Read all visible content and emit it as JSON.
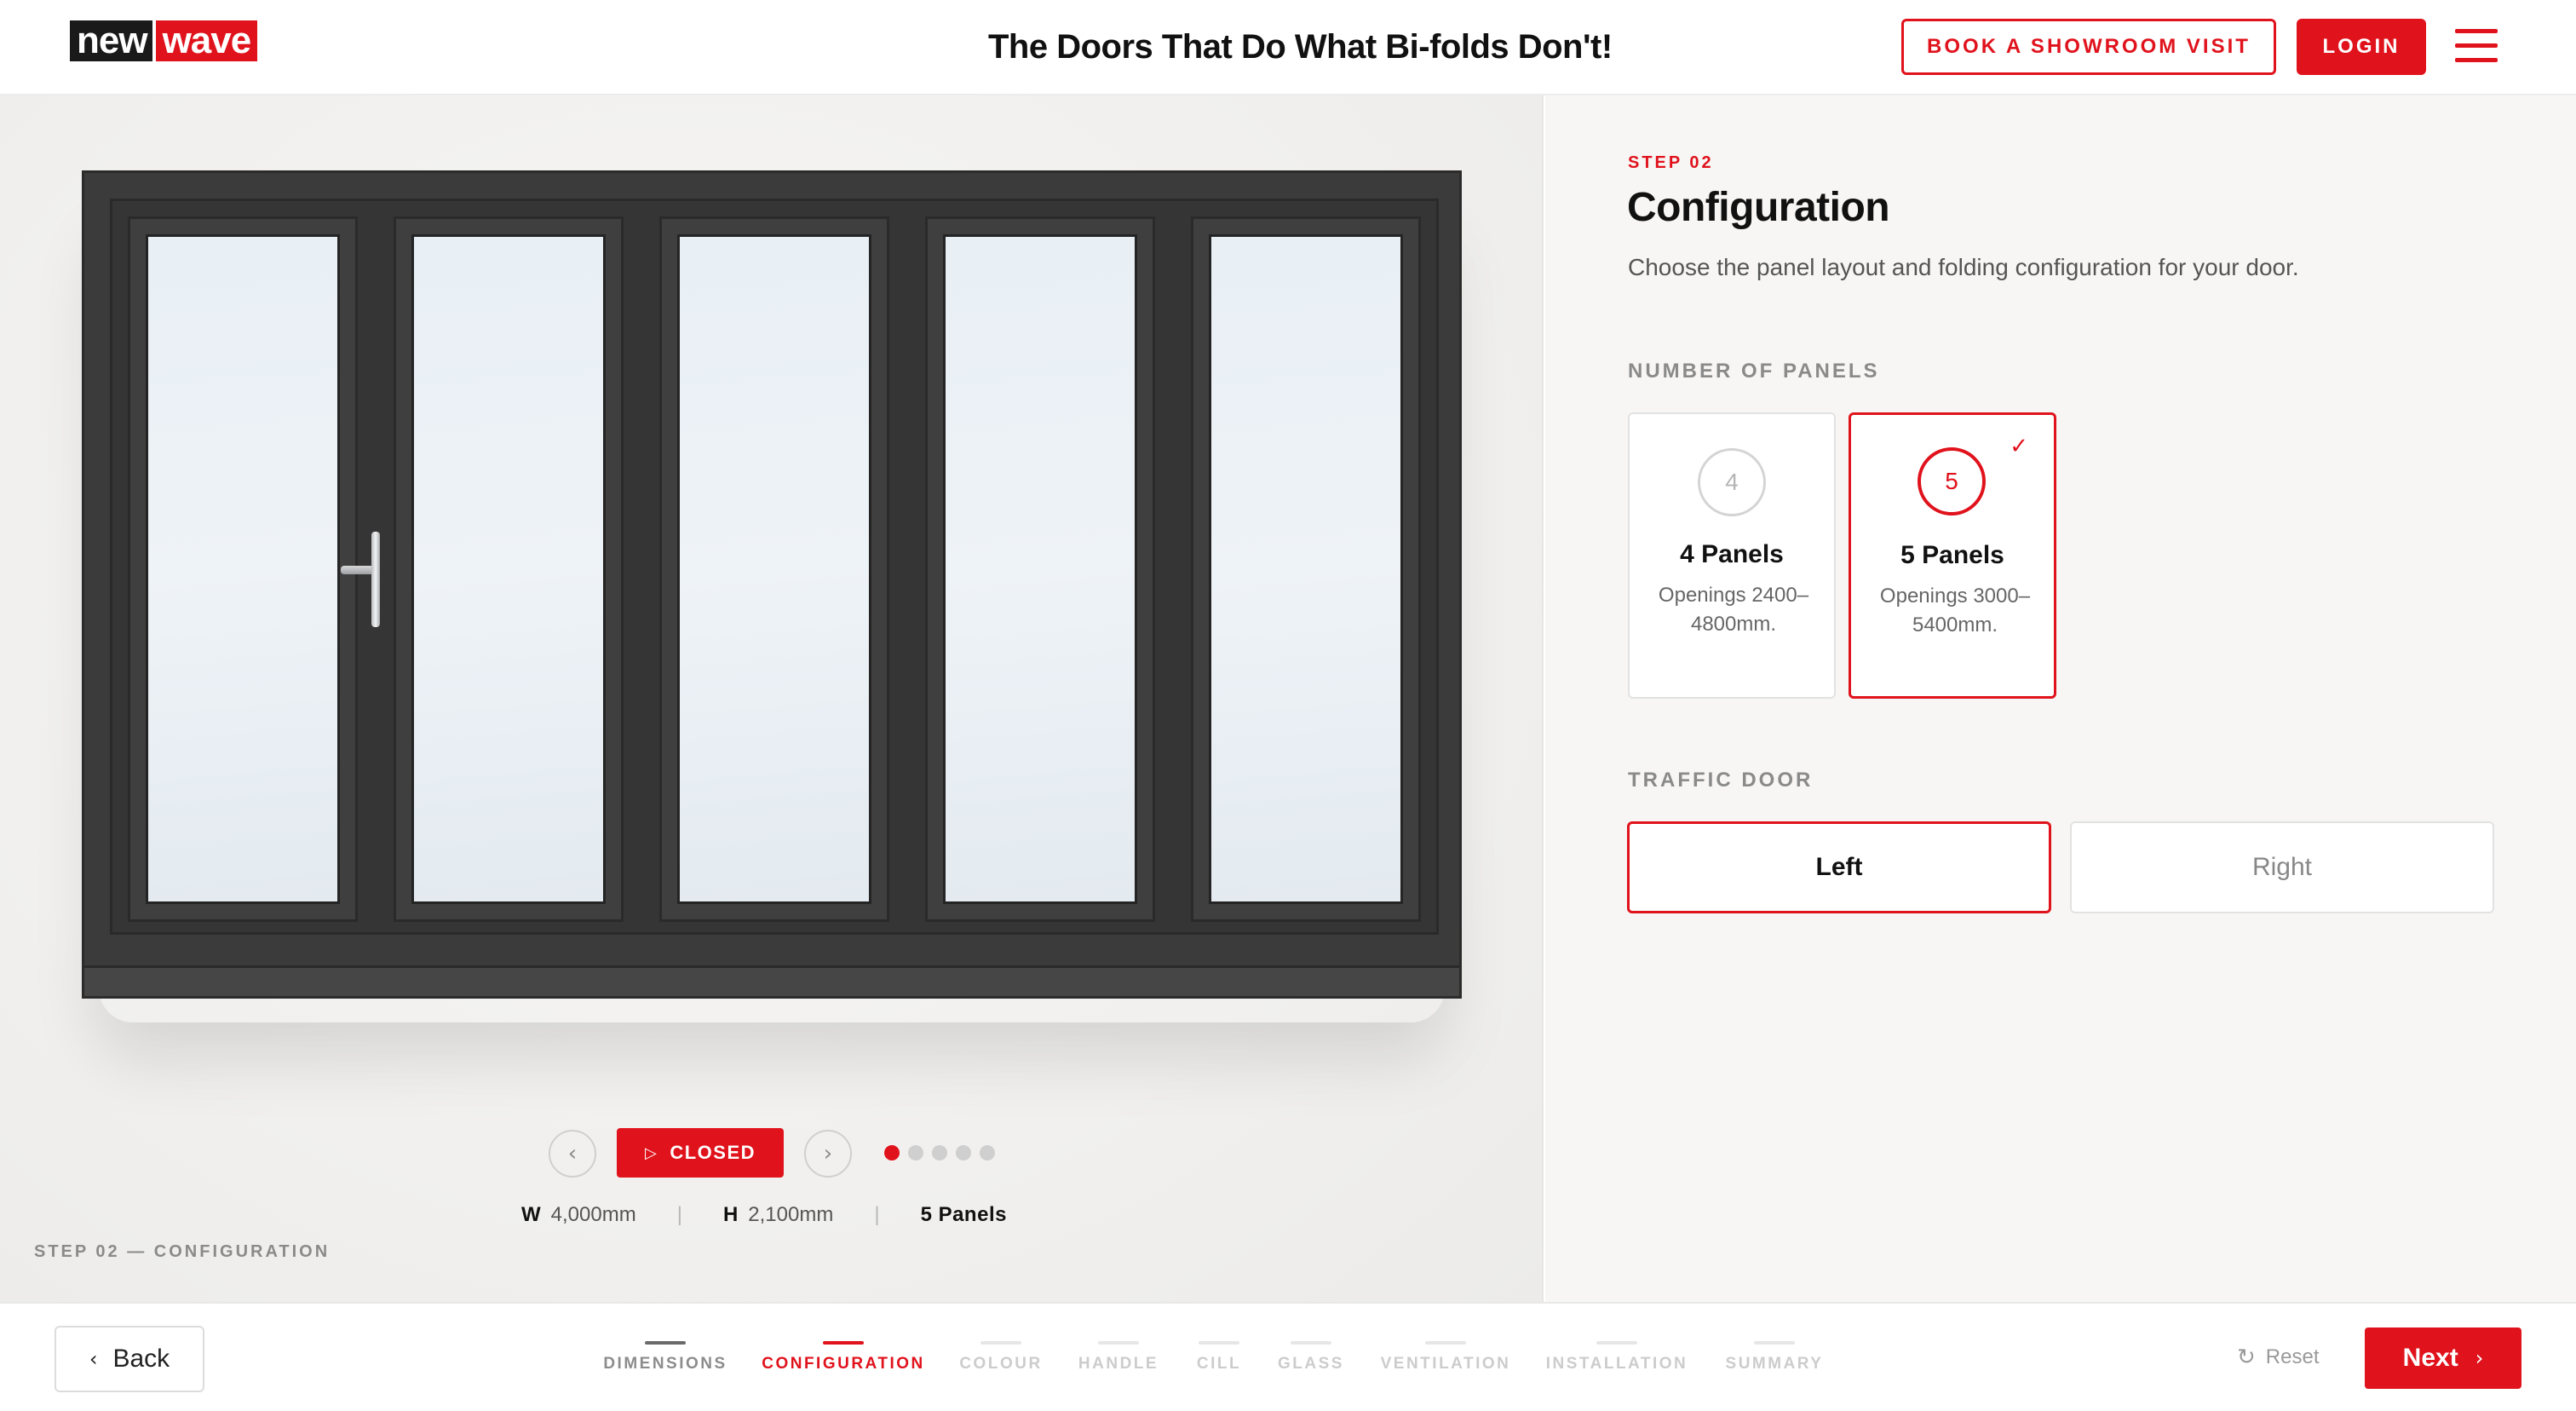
{
  "header": {
    "logo_left": "new",
    "logo_right": "wave",
    "tagline": "The Doors That Do What Bi-folds Don't!",
    "showroom_label": "BOOK A SHOWROOM VISIT",
    "login_label": "LOGIN",
    "menu_icon": "hamburger-icon"
  },
  "preview": {
    "view_state": "CLOSED",
    "prev_icon": "chevron-left-icon",
    "next_icon": "chevron-right-icon",
    "view_count": 5,
    "active_view": 1,
    "width_label": "W",
    "width_value": "4,000mm",
    "height_label": "H",
    "height_value": "2,100mm",
    "panels_value": "5 Panels",
    "step_caption": "STEP 02 — CONFIGURATION",
    "frame_color": "#3b3b3b"
  },
  "config": {
    "step": "STEP 02",
    "title": "Configuration",
    "description": "Choose the panel layout and folding configuration for your door.",
    "panels_section": "NUMBER OF PANELS",
    "panel_options": [
      {
        "number": "4",
        "name": "4 Panels",
        "sub": "Openings 2400–4800mm.",
        "selected": false
      },
      {
        "number": "5",
        "name": "5 Panels",
        "sub": "Openings 3000–5400mm.",
        "selected": true
      }
    ],
    "traffic_section": "TRAFFIC DOOR",
    "traffic_options": [
      {
        "label": "Left",
        "selected": true
      },
      {
        "label": "Right",
        "selected": false
      }
    ]
  },
  "footer": {
    "back_label": "Back",
    "steps": [
      {
        "label": "DIMENSIONS",
        "state": "done"
      },
      {
        "label": "CONFIGURATION",
        "state": "active"
      },
      {
        "label": "COLOUR",
        "state": "todo"
      },
      {
        "label": "HANDLE",
        "state": "todo"
      },
      {
        "label": "CILL",
        "state": "todo"
      },
      {
        "label": "GLASS",
        "state": "todo"
      },
      {
        "label": "VENTILATION",
        "state": "todo"
      },
      {
        "label": "INSTALLATION",
        "state": "todo"
      },
      {
        "label": "SUMMARY",
        "state": "todo"
      }
    ],
    "reset_label": "Reset",
    "next_label": "Next"
  },
  "colors": {
    "accent": "#e0121c",
    "dark": "#1a1a1a"
  }
}
